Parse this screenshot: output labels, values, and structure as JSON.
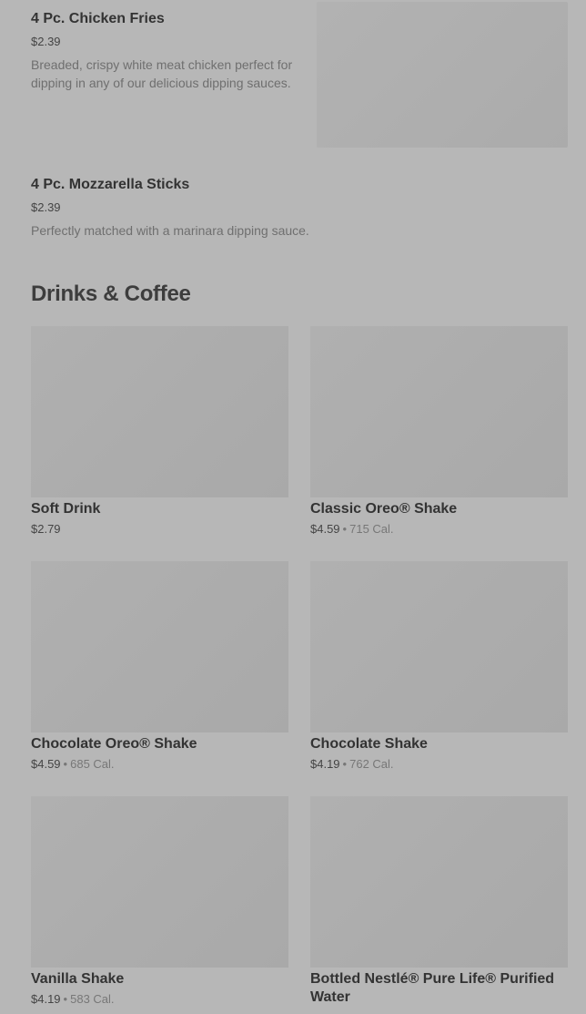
{
  "previous_section": {
    "items": [
      {
        "name": "4 Pc. Chicken Fries",
        "price": "$2.39",
        "description": "Breaded, crispy white meat chicken perfect for dipping in any of our delicious dipping sauces."
      },
      {
        "name": "4 Pc. Mozzarella Sticks",
        "price": "$2.39",
        "description": "Perfectly matched with a marinara dipping sauce."
      }
    ]
  },
  "drinks_section": {
    "title": "Drinks & Coffee",
    "separator": "•",
    "items": [
      {
        "name": "Soft Drink",
        "price": "$2.79",
        "calories": ""
      },
      {
        "name": "Classic Oreo® Shake",
        "price": "$4.59",
        "calories": "715 Cal."
      },
      {
        "name": "Chocolate Oreo® Shake",
        "price": "$4.59",
        "calories": "685 Cal."
      },
      {
        "name": "Chocolate Shake",
        "price": "$4.19",
        "calories": "762 Cal."
      },
      {
        "name": "Vanilla Shake",
        "price": "$4.19",
        "calories": "583 Cal."
      },
      {
        "name": "Bottled Nestlé® Pure Life® Purified Water",
        "price": "",
        "calories": ""
      }
    ]
  },
  "colors": {
    "overlay_background": "#b7b7b7",
    "placeholder_image": "#adadad",
    "text_primary": "#333333",
    "text_secondary": "#6f6f6f"
  }
}
